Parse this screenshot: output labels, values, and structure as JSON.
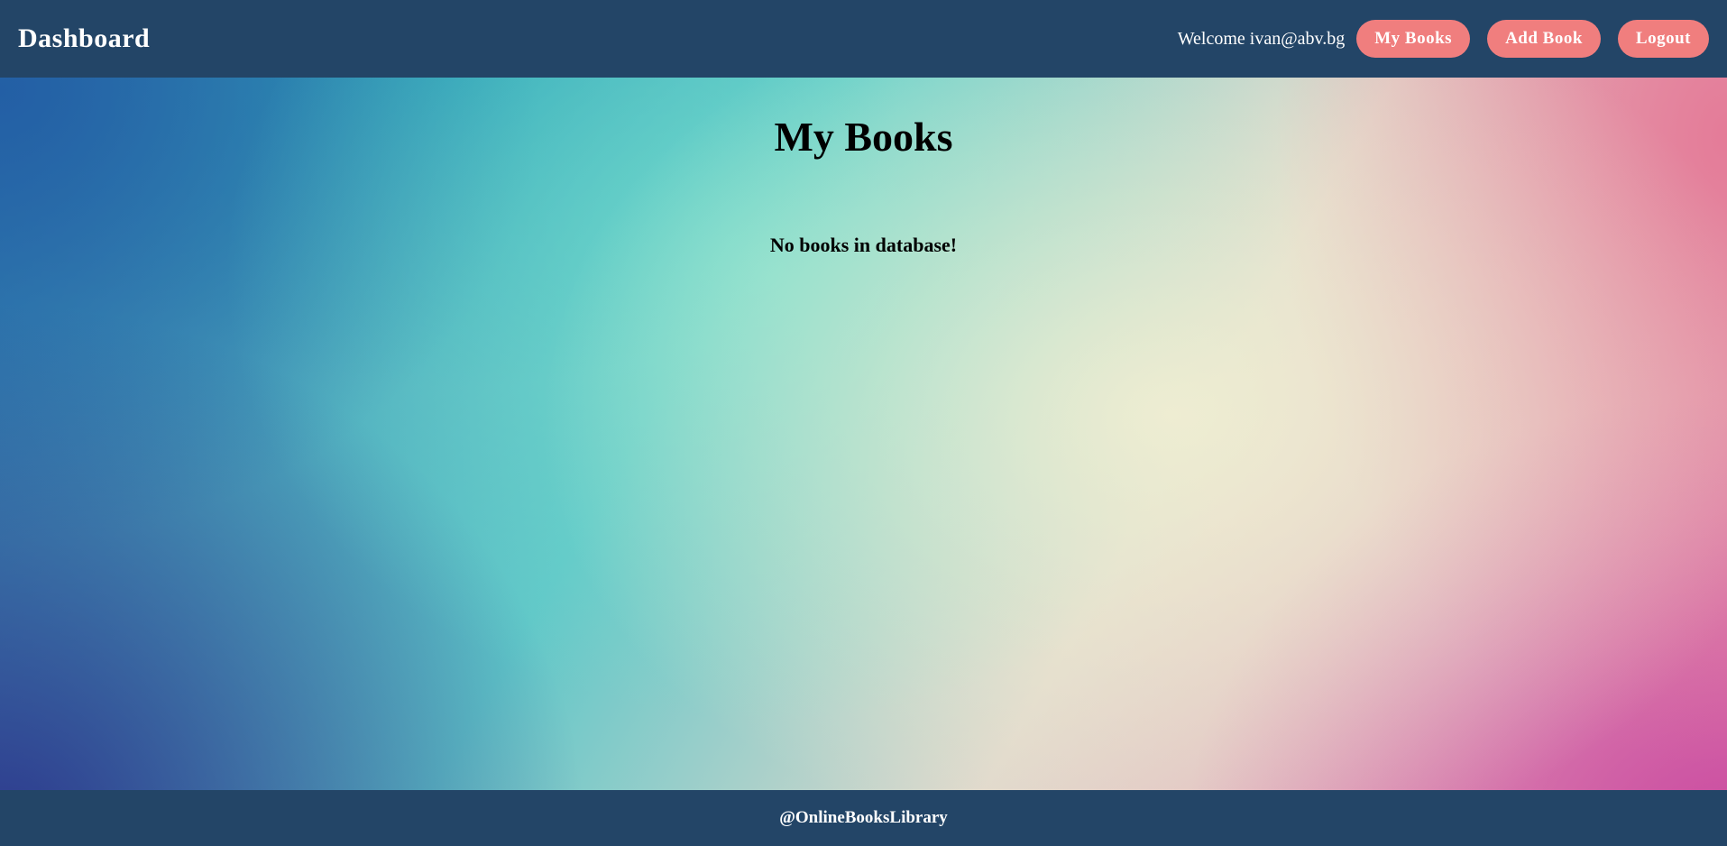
{
  "header": {
    "brand": "Dashboard",
    "welcome": "Welcome ivan@abv.bg",
    "nav": {
      "my_books": "My Books",
      "add_book": "Add Book",
      "logout": "Logout"
    }
  },
  "main": {
    "title": "My Books",
    "empty_message": "No books in database!"
  },
  "footer": {
    "text": "@OnlineBooksLibrary"
  },
  "colors": {
    "header_bg": "#234567",
    "button_bg": "#f07e7e",
    "text_on_dark": "#ffffff"
  }
}
